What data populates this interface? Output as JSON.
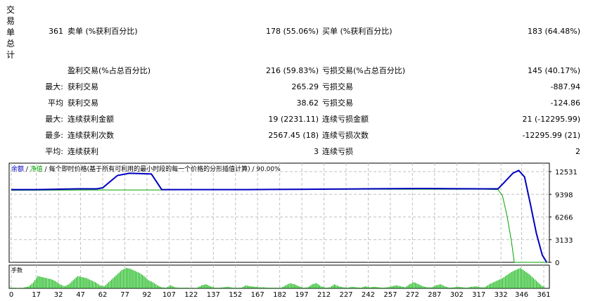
{
  "summary": {
    "section_label": "交易单总计",
    "total_trades": "361",
    "short_label": "卖单 (%获利百分比)",
    "short_value": "178 (55.06%)",
    "long_label": "买单 (%获利百分比)",
    "long_value": "183 (64.48%)",
    "rows": [
      {
        "prefix": "",
        "label1": "盈利交易(%占总百分比)",
        "value1": "216 (59.83%)",
        "label2": "亏损交易(%占总百分比)",
        "value2": "145 (40.17%)"
      },
      {
        "prefix": "最大:",
        "label1": "获利交易",
        "value1": "265.29",
        "label2": "亏损交易",
        "value2": "-887.94"
      },
      {
        "prefix": "平均",
        "label1": "获利交易",
        "value1": "38.62",
        "label2": "亏损交易",
        "value2": "-124.86"
      },
      {
        "prefix": "最大:",
        "label1": "连续获利金额",
        "value1": "19 (2231.11)",
        "label2": "连续亏损金额",
        "value2": "21 (-12295.99)"
      },
      {
        "prefix": "最多:",
        "label1": "连续获利次数",
        "value1": "2567.45 (18)",
        "label2": "连续亏损次数",
        "value2": "-12295.99 (21)"
      },
      {
        "prefix": "平均:",
        "label1": "连续获利",
        "value1": "3",
        "label2": "连续亏损",
        "value2": "2"
      }
    ]
  },
  "chart_data": {
    "type": "line",
    "legend": {
      "balance": "余额",
      "sep1": " / ",
      "equity": "净值",
      "sep2": " / ",
      "desc": "每个即时价格(基于所有可利用的最小时段的每一个价格的分形插值计算)",
      "sep3": " / ",
      "quality": "90.00%"
    },
    "colors": {
      "balance": "#0000c0",
      "equity": "#00a000",
      "volume": "#00b000",
      "grid": "#c0c0c0"
    },
    "xlim": [
      0,
      364
    ],
    "ylim": [
      0,
      13700
    ],
    "yticks": [
      "12531",
      "9398",
      "6266",
      "3133",
      "0"
    ],
    "ytick_values": [
      12531,
      9398,
      6266,
      3133,
      0
    ],
    "xticks": [
      "0",
      "17",
      "32",
      "47",
      "62",
      "77",
      "92",
      "107",
      "122",
      "137",
      "152",
      "167",
      "182",
      "197",
      "212",
      "227",
      "242",
      "257",
      "272",
      "287",
      "302",
      "317",
      "332",
      "346",
      "361"
    ],
    "balance": [
      [
        0,
        10050
      ],
      [
        17,
        10050
      ],
      [
        30,
        10100
      ],
      [
        45,
        10150
      ],
      [
        58,
        10150
      ],
      [
        62,
        10300
      ],
      [
        72,
        12000
      ],
      [
        80,
        12300
      ],
      [
        88,
        12250
      ],
      [
        95,
        12200
      ],
      [
        102,
        10050
      ],
      [
        160,
        10050
      ],
      [
        200,
        10100
      ],
      [
        240,
        10150
      ],
      [
        280,
        10200
      ],
      [
        320,
        10150
      ],
      [
        330,
        10150
      ],
      [
        334,
        11000
      ],
      [
        340,
        12300
      ],
      [
        344,
        12700
      ],
      [
        348,
        11800
      ],
      [
        352,
        8000
      ],
      [
        356,
        4000
      ],
      [
        360,
        1000
      ],
      [
        363,
        0
      ]
    ],
    "equity": [
      [
        0,
        9950
      ],
      [
        60,
        10000
      ],
      [
        100,
        10000
      ],
      [
        200,
        10100
      ],
      [
        320,
        10100
      ],
      [
        330,
        10050
      ],
      [
        333,
        9200
      ],
      [
        336,
        6500
      ],
      [
        339,
        3000
      ],
      [
        341,
        0
      ],
      [
        364,
        0
      ]
    ],
    "volume_label": "手数",
    "volume_step": 3,
    "volume": [
      0.3,
      0.3,
      0,
      0.5,
      1,
      3,
      6,
      5.5,
      5,
      4.5,
      3.5,
      2,
      1,
      2,
      4,
      6,
      5.5,
      5,
      4,
      3,
      1.5,
      1,
      3,
      5,
      7,
      9,
      10,
      9.5,
      8.5,
      7.5,
      6,
      4,
      3,
      1.5,
      0.5,
      0.3,
      1.5,
      0.5,
      0.3,
      0.3,
      0.3,
      0,
      0.3,
      1.5,
      2,
      1,
      0.3,
      0.3,
      0.5,
      0.8,
      0.3,
      0.3,
      0.3,
      1.5,
      1,
      0.8,
      0.5,
      0.5,
      0.3,
      0.3,
      0.3,
      0.3,
      1.5,
      2.5,
      2,
      1,
      0.3,
      0.5,
      2,
      2.5,
      1,
      0.3,
      0.5,
      2,
      1,
      0.5,
      0.3,
      0.8,
      0.5,
      0.3,
      1,
      0.5,
      0.8,
      0.5,
      0.3,
      0.5,
      1,
      1.5,
      1,
      0.5,
      2,
      3,
      2,
      1,
      0.5,
      0.5,
      1.5,
      2,
      1,
      0.3,
      0.5,
      0.8,
      0.5,
      0.3,
      0.8,
      1,
      0.5,
      0.5,
      2,
      3,
      4,
      5,
      6.5,
      8,
      9,
      10,
      8.5,
      7,
      5,
      3,
      1
    ]
  }
}
